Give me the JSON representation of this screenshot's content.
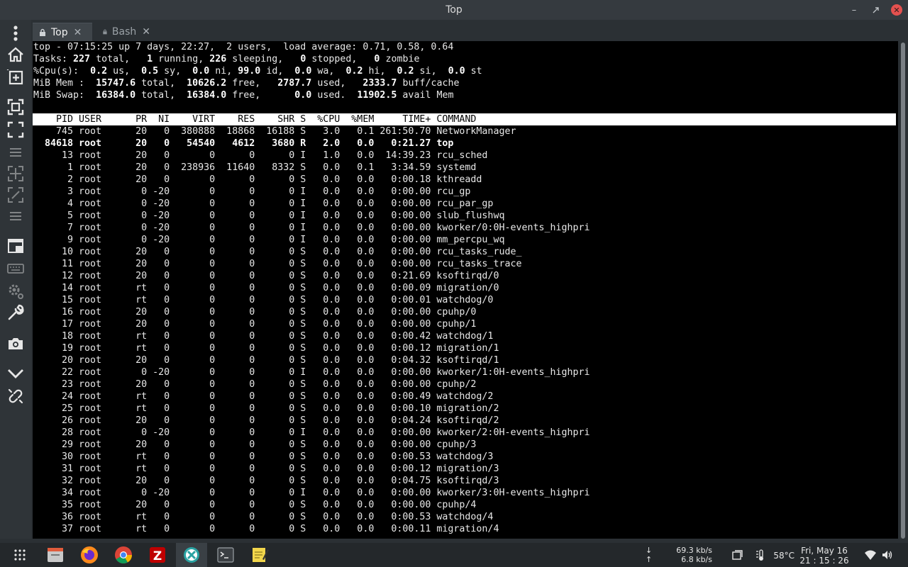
{
  "window": {
    "title": "Top"
  },
  "tabs": [
    {
      "label": "Top",
      "active": true
    },
    {
      "label": "Bash",
      "active": false
    }
  ],
  "summary_lines": [
    "top - 07:15:25 up 7 days, 22:27,  2 users,  load average: 0.71, 0.58, 0.64",
    "Tasks: 227 total,   1 running, 226 sleeping,   0 stopped,   0 zombie",
    "%Cpu(s):  0.2 us,  0.5 sy,  0.0 ni, 99.0 id,  0.0 wa,  0.2 hi,  0.2 si,  0.0 st",
    "MiB Mem :  15747.6 total,  10626.2 free,   2787.7 used,   2333.7 buff/cache",
    "MiB Swap:  16384.0 total,  16384.0 free,      0.0 used.  11902.5 avail Mem"
  ],
  "columns": [
    "PID",
    "USER",
    "PR",
    "NI",
    "VIRT",
    "RES",
    "SHR",
    "S",
    "%CPU",
    "%MEM",
    "TIME+",
    "COMMAND"
  ],
  "processes": [
    {
      "pid": "745",
      "user": "root",
      "pr": "20",
      "ni": "0",
      "virt": "380888",
      "res": "18868",
      "shr": "16188",
      "s": "S",
      "cpu": "3.0",
      "mem": "0.1",
      "time": "261:50.70",
      "cmd": "NetworkManager"
    },
    {
      "pid": "84618",
      "user": "root",
      "pr": "20",
      "ni": "0",
      "virt": "54540",
      "res": "4612",
      "shr": "3680",
      "s": "R",
      "cpu": "2.0",
      "mem": "0.0",
      "time": "0:21.27",
      "cmd": "top",
      "bold": true
    },
    {
      "pid": "13",
      "user": "root",
      "pr": "20",
      "ni": "0",
      "virt": "0",
      "res": "0",
      "shr": "0",
      "s": "I",
      "cpu": "1.0",
      "mem": "0.0",
      "time": "14:39.23",
      "cmd": "rcu_sched"
    },
    {
      "pid": "1",
      "user": "root",
      "pr": "20",
      "ni": "0",
      "virt": "238936",
      "res": "11640",
      "shr": "8332",
      "s": "S",
      "cpu": "0.0",
      "mem": "0.1",
      "time": "3:34.59",
      "cmd": "systemd"
    },
    {
      "pid": "2",
      "user": "root",
      "pr": "20",
      "ni": "0",
      "virt": "0",
      "res": "0",
      "shr": "0",
      "s": "S",
      "cpu": "0.0",
      "mem": "0.0",
      "time": "0:00.18",
      "cmd": "kthreadd"
    },
    {
      "pid": "3",
      "user": "root",
      "pr": "0",
      "ni": "-20",
      "virt": "0",
      "res": "0",
      "shr": "0",
      "s": "I",
      "cpu": "0.0",
      "mem": "0.0",
      "time": "0:00.00",
      "cmd": "rcu_gp"
    },
    {
      "pid": "4",
      "user": "root",
      "pr": "0",
      "ni": "-20",
      "virt": "0",
      "res": "0",
      "shr": "0",
      "s": "I",
      "cpu": "0.0",
      "mem": "0.0",
      "time": "0:00.00",
      "cmd": "rcu_par_gp"
    },
    {
      "pid": "5",
      "user": "root",
      "pr": "0",
      "ni": "-20",
      "virt": "0",
      "res": "0",
      "shr": "0",
      "s": "I",
      "cpu": "0.0",
      "mem": "0.0",
      "time": "0:00.00",
      "cmd": "slub_flushwq"
    },
    {
      "pid": "7",
      "user": "root",
      "pr": "0",
      "ni": "-20",
      "virt": "0",
      "res": "0",
      "shr": "0",
      "s": "I",
      "cpu": "0.0",
      "mem": "0.0",
      "time": "0:00.00",
      "cmd": "kworker/0:0H-events_highpri"
    },
    {
      "pid": "9",
      "user": "root",
      "pr": "0",
      "ni": "-20",
      "virt": "0",
      "res": "0",
      "shr": "0",
      "s": "I",
      "cpu": "0.0",
      "mem": "0.0",
      "time": "0:00.00",
      "cmd": "mm_percpu_wq"
    },
    {
      "pid": "10",
      "user": "root",
      "pr": "20",
      "ni": "0",
      "virt": "0",
      "res": "0",
      "shr": "0",
      "s": "S",
      "cpu": "0.0",
      "mem": "0.0",
      "time": "0:00.00",
      "cmd": "rcu_tasks_rude_"
    },
    {
      "pid": "11",
      "user": "root",
      "pr": "20",
      "ni": "0",
      "virt": "0",
      "res": "0",
      "shr": "0",
      "s": "S",
      "cpu": "0.0",
      "mem": "0.0",
      "time": "0:00.00",
      "cmd": "rcu_tasks_trace"
    },
    {
      "pid": "12",
      "user": "root",
      "pr": "20",
      "ni": "0",
      "virt": "0",
      "res": "0",
      "shr": "0",
      "s": "S",
      "cpu": "0.0",
      "mem": "0.0",
      "time": "0:21.69",
      "cmd": "ksoftirqd/0"
    },
    {
      "pid": "14",
      "user": "root",
      "pr": "rt",
      "ni": "0",
      "virt": "0",
      "res": "0",
      "shr": "0",
      "s": "S",
      "cpu": "0.0",
      "mem": "0.0",
      "time": "0:00.09",
      "cmd": "migration/0"
    },
    {
      "pid": "15",
      "user": "root",
      "pr": "rt",
      "ni": "0",
      "virt": "0",
      "res": "0",
      "shr": "0",
      "s": "S",
      "cpu": "0.0",
      "mem": "0.0",
      "time": "0:00.01",
      "cmd": "watchdog/0"
    },
    {
      "pid": "16",
      "user": "root",
      "pr": "20",
      "ni": "0",
      "virt": "0",
      "res": "0",
      "shr": "0",
      "s": "S",
      "cpu": "0.0",
      "mem": "0.0",
      "time": "0:00.00",
      "cmd": "cpuhp/0"
    },
    {
      "pid": "17",
      "user": "root",
      "pr": "20",
      "ni": "0",
      "virt": "0",
      "res": "0",
      "shr": "0",
      "s": "S",
      "cpu": "0.0",
      "mem": "0.0",
      "time": "0:00.00",
      "cmd": "cpuhp/1"
    },
    {
      "pid": "18",
      "user": "root",
      "pr": "rt",
      "ni": "0",
      "virt": "0",
      "res": "0",
      "shr": "0",
      "s": "S",
      "cpu": "0.0",
      "mem": "0.0",
      "time": "0:00.42",
      "cmd": "watchdog/1"
    },
    {
      "pid": "19",
      "user": "root",
      "pr": "rt",
      "ni": "0",
      "virt": "0",
      "res": "0",
      "shr": "0",
      "s": "S",
      "cpu": "0.0",
      "mem": "0.0",
      "time": "0:00.12",
      "cmd": "migration/1"
    },
    {
      "pid": "20",
      "user": "root",
      "pr": "20",
      "ni": "0",
      "virt": "0",
      "res": "0",
      "shr": "0",
      "s": "S",
      "cpu": "0.0",
      "mem": "0.0",
      "time": "0:04.32",
      "cmd": "ksoftirqd/1"
    },
    {
      "pid": "22",
      "user": "root",
      "pr": "0",
      "ni": "-20",
      "virt": "0",
      "res": "0",
      "shr": "0",
      "s": "I",
      "cpu": "0.0",
      "mem": "0.0",
      "time": "0:00.00",
      "cmd": "kworker/1:0H-events_highpri"
    },
    {
      "pid": "23",
      "user": "root",
      "pr": "20",
      "ni": "0",
      "virt": "0",
      "res": "0",
      "shr": "0",
      "s": "S",
      "cpu": "0.0",
      "mem": "0.0",
      "time": "0:00.00",
      "cmd": "cpuhp/2"
    },
    {
      "pid": "24",
      "user": "root",
      "pr": "rt",
      "ni": "0",
      "virt": "0",
      "res": "0",
      "shr": "0",
      "s": "S",
      "cpu": "0.0",
      "mem": "0.0",
      "time": "0:00.49",
      "cmd": "watchdog/2"
    },
    {
      "pid": "25",
      "user": "root",
      "pr": "rt",
      "ni": "0",
      "virt": "0",
      "res": "0",
      "shr": "0",
      "s": "S",
      "cpu": "0.0",
      "mem": "0.0",
      "time": "0:00.10",
      "cmd": "migration/2"
    },
    {
      "pid": "26",
      "user": "root",
      "pr": "20",
      "ni": "0",
      "virt": "0",
      "res": "0",
      "shr": "0",
      "s": "S",
      "cpu": "0.0",
      "mem": "0.0",
      "time": "0:04.24",
      "cmd": "ksoftirqd/2"
    },
    {
      "pid": "28",
      "user": "root",
      "pr": "0",
      "ni": "-20",
      "virt": "0",
      "res": "0",
      "shr": "0",
      "s": "I",
      "cpu": "0.0",
      "mem": "0.0",
      "time": "0:00.00",
      "cmd": "kworker/2:0H-events_highpri"
    },
    {
      "pid": "29",
      "user": "root",
      "pr": "20",
      "ni": "0",
      "virt": "0",
      "res": "0",
      "shr": "0",
      "s": "S",
      "cpu": "0.0",
      "mem": "0.0",
      "time": "0:00.00",
      "cmd": "cpuhp/3"
    },
    {
      "pid": "30",
      "user": "root",
      "pr": "rt",
      "ni": "0",
      "virt": "0",
      "res": "0",
      "shr": "0",
      "s": "S",
      "cpu": "0.0",
      "mem": "0.0",
      "time": "0:00.53",
      "cmd": "watchdog/3"
    },
    {
      "pid": "31",
      "user": "root",
      "pr": "rt",
      "ni": "0",
      "virt": "0",
      "res": "0",
      "shr": "0",
      "s": "S",
      "cpu": "0.0",
      "mem": "0.0",
      "time": "0:00.12",
      "cmd": "migration/3"
    },
    {
      "pid": "32",
      "user": "root",
      "pr": "20",
      "ni": "0",
      "virt": "0",
      "res": "0",
      "shr": "0",
      "s": "S",
      "cpu": "0.0",
      "mem": "0.0",
      "time": "0:04.75",
      "cmd": "ksoftirqd/3"
    },
    {
      "pid": "34",
      "user": "root",
      "pr": "0",
      "ni": "-20",
      "virt": "0",
      "res": "0",
      "shr": "0",
      "s": "I",
      "cpu": "0.0",
      "mem": "0.0",
      "time": "0:00.00",
      "cmd": "kworker/3:0H-events_highpri"
    },
    {
      "pid": "35",
      "user": "root",
      "pr": "20",
      "ni": "0",
      "virt": "0",
      "res": "0",
      "shr": "0",
      "s": "S",
      "cpu": "0.0",
      "mem": "0.0",
      "time": "0:00.00",
      "cmd": "cpuhp/4"
    },
    {
      "pid": "36",
      "user": "root",
      "pr": "rt",
      "ni": "0",
      "virt": "0",
      "res": "0",
      "shr": "0",
      "s": "S",
      "cpu": "0.0",
      "mem": "0.0",
      "time": "0:00.53",
      "cmd": "watchdog/4"
    },
    {
      "pid": "37",
      "user": "root",
      "pr": "rt",
      "ni": "0",
      "virt": "0",
      "res": "0",
      "shr": "0",
      "s": "S",
      "cpu": "0.0",
      "mem": "0.0",
      "time": "0:00.11",
      "cmd": "migration/4"
    }
  ],
  "sidebar_icons": [
    "menu-dots-icon",
    "home-icon",
    "new-tab-icon",
    "split-icon",
    "fullscreen-icon",
    "list-icon",
    "grid-icon",
    "grid-alt-icon",
    "list-alt-icon",
    "window-icon",
    "keyboard-icon",
    "settings-icon",
    "wrench-icon",
    "camera-icon",
    "chevron-down-icon",
    "link-icon"
  ],
  "taskbar": {
    "apps": [
      "app-grid-icon",
      "files-icon",
      "firefox-icon",
      "chrome-icon",
      "filezilla-icon",
      "xmind-icon",
      "terminal-icon",
      "notes-icon"
    ],
    "net_down": "69.3 kb/s",
    "net_up": "6.8 kb/s",
    "temperature": "58°C",
    "date": "Fri, May 16",
    "time": "21 : 15 : 26"
  },
  "colors": {
    "terminal_bg": "#000000",
    "header_bg": "#ffffff",
    "close_red": "#e4514f",
    "chrome_bg": "#2b3034"
  }
}
